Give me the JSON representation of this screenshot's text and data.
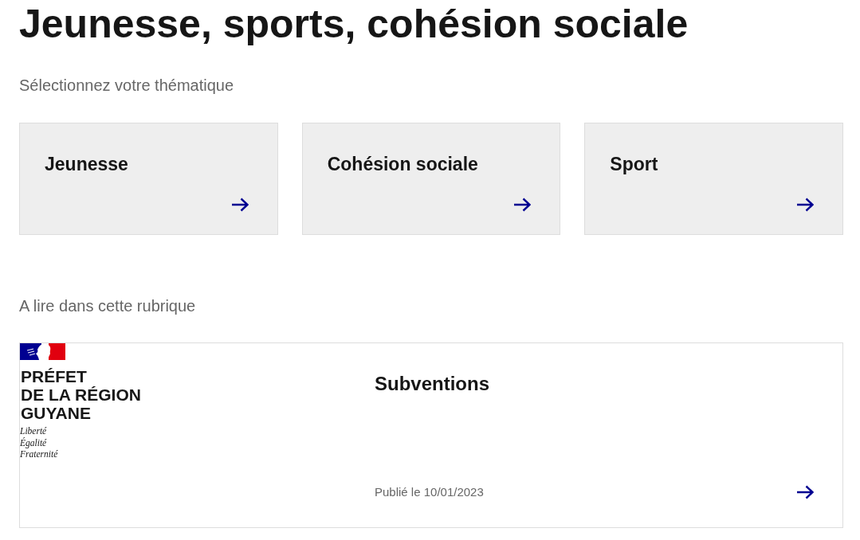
{
  "page": {
    "title": "Jeunesse, sports, cohésion sociale",
    "subtitle": "Sélectionnez votre thématique"
  },
  "themes": [
    {
      "label": "Jeunesse"
    },
    {
      "label": "Cohésion sociale"
    },
    {
      "label": "Sport"
    }
  ],
  "related": {
    "heading": "A lire dans cette rubrique",
    "cards": [
      {
        "logo": {
          "name": "PRÉFET\nDE LA RÉGION\nGUYANE",
          "motto": "Liberté\nÉgalité\nFraternité"
        },
        "title": "Subventions",
        "date": "Publié le 10/01/2023"
      }
    ]
  }
}
